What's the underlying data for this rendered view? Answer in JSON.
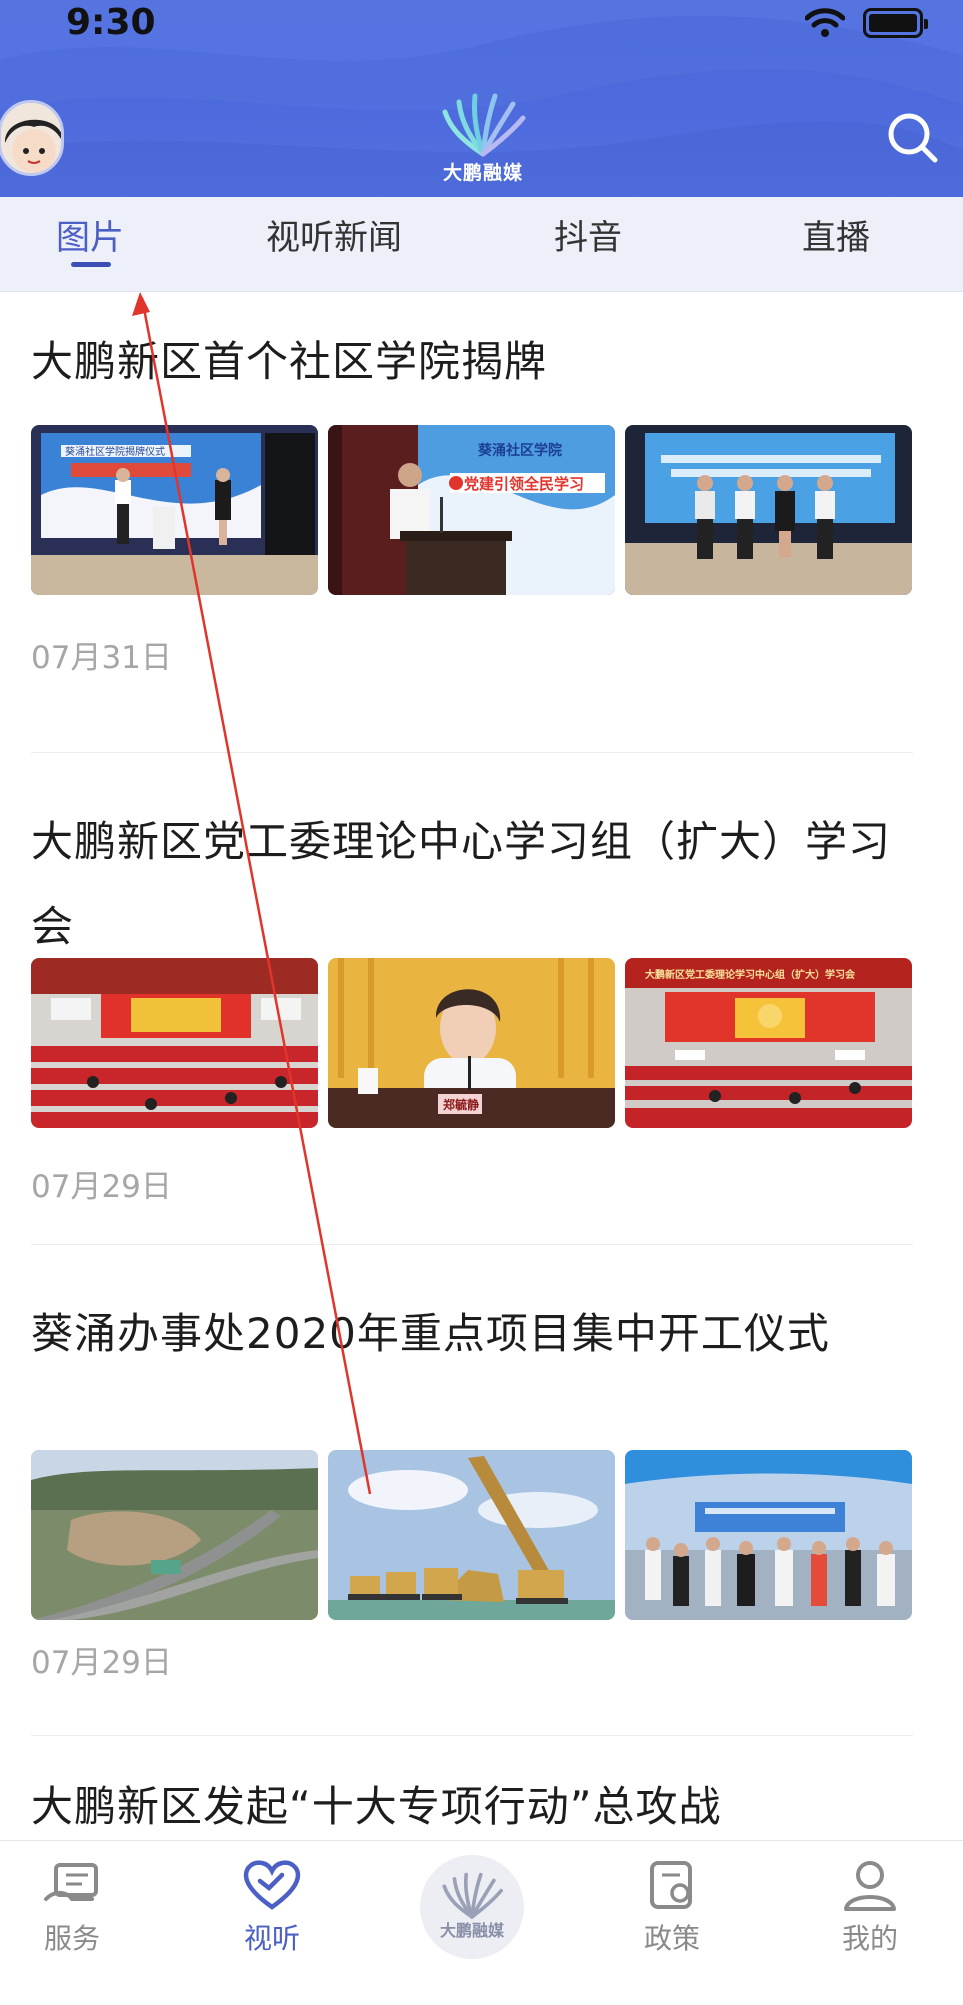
{
  "status_bar": {
    "time": "9:30"
  },
  "header": {
    "logo_text": "大鹏融媒"
  },
  "tabs": [
    {
      "label": "图片",
      "active": true
    },
    {
      "label": "视听新闻",
      "active": false
    },
    {
      "label": "抖音",
      "active": false
    },
    {
      "label": "直播",
      "active": false
    }
  ],
  "articles": [
    {
      "title": "大鹏新区首个社区学院揭牌",
      "date": "07月31日"
    },
    {
      "title": "大鹏新区党工委理论中心学习组（扩大）学习会",
      "date": "07月29日"
    },
    {
      "title": "葵涌办事处2020年重点项目集中开工仪式",
      "date": "07月29日"
    },
    {
      "title": "大鹏新区发起“十大专项行动”总攻战",
      "date": ""
    }
  ],
  "photo_captions": {
    "a1_banner": "葵涌社区学院揭牌仪式",
    "a2_banner": "葵涌社区学院",
    "a2_slogan": "党建引领全民学习",
    "a2_nameplate": "",
    "a3_nameplate": "郑毓静",
    "a3_banner": "大鹏新区党工委理论学习中心组（扩大）学习会"
  },
  "bottom_nav": {
    "items": [
      {
        "label": "服务",
        "icon": "service-icon"
      },
      {
        "label": "视听",
        "icon": "heart-icon",
        "active": true
      },
      {
        "label": "大鹏融媒",
        "icon": "logo-icon"
      },
      {
        "label": "政策",
        "icon": "policy-icon"
      },
      {
        "label": "我的",
        "icon": "profile-icon"
      }
    ]
  },
  "colors": {
    "header_blue": "#4d6bdc",
    "accent": "#4c5fc4",
    "tab_bg": "#eef0f9",
    "date_gray": "#a6a6a6",
    "annotation_red": "#e0352b"
  }
}
